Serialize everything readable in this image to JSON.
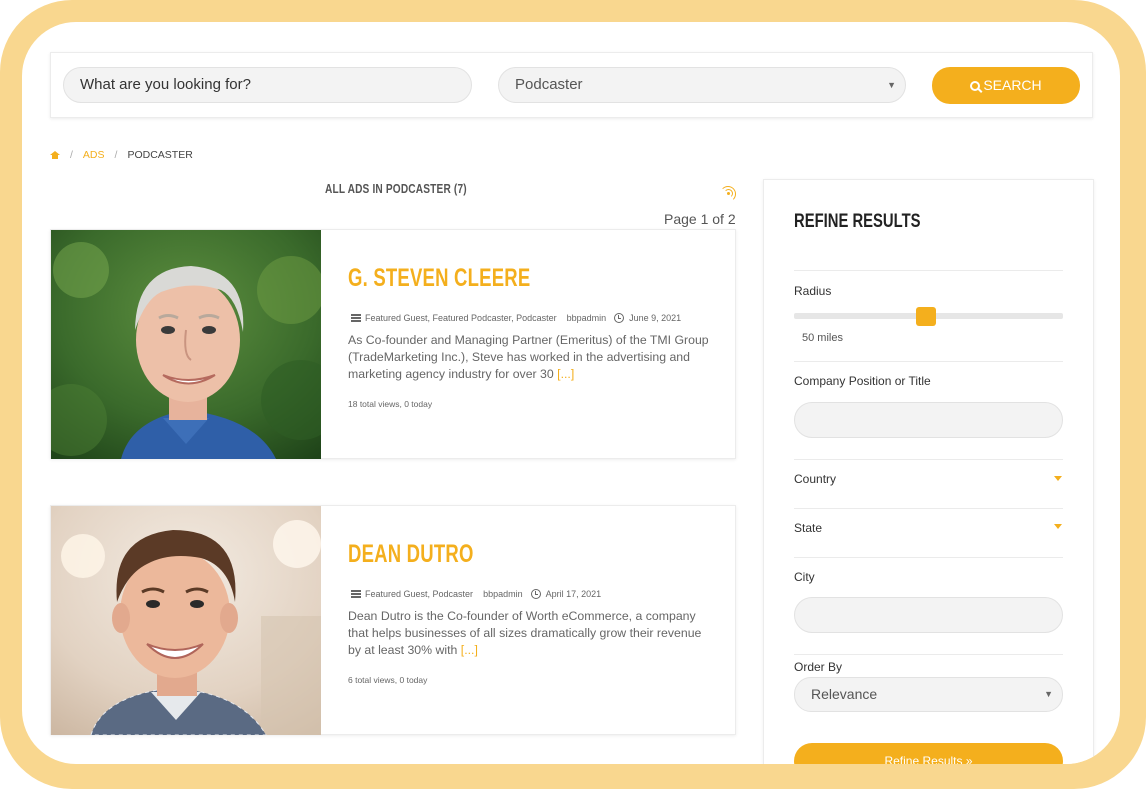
{
  "search": {
    "placeholder": "What are you looking for?",
    "category": "Podcaster",
    "button_label": "SEARCH"
  },
  "breadcrumb": {
    "ads": "ADS",
    "current": "PODCASTER"
  },
  "listing": {
    "title": "ALL ADS IN PODCASTER (7)",
    "page_info": "Page 1 of 2"
  },
  "ads": [
    {
      "name": "G. STEVEN CLEERE",
      "categories": "Featured Guest, Featured Podcaster, Podcaster",
      "author": "bbpadmin",
      "date": "June 9, 2021",
      "description": "As Co-founder and Managing Partner (Emeritus) of the TMI Group (TradeMarketing Inc.), Steve has worked in the advertising and marketing agency industry for over 30",
      "more": "[...]",
      "views": "18 total views, 0 today"
    },
    {
      "name": "DEAN DUTRO",
      "categories": "Featured Guest, Podcaster",
      "author": "bbpadmin",
      "date": "April 17, 2021",
      "description": "Dean Dutro is the Co-founder of Worth eCommerce, a company that helps businesses of all sizes dramatically grow their revenue by at least 30% with",
      "more": "[...]",
      "views": "6 total views, 0 today"
    }
  ],
  "sidebar": {
    "title": "REFINE RESULTS",
    "radius_label": "Radius",
    "radius_value": "50 miles",
    "radius_fraction": 0.49,
    "company_label": "Company Position or Title",
    "country_label": "Country",
    "state_label": "State",
    "city_label": "City",
    "order_label": "Order By",
    "order_value": "Relevance",
    "refine_button": "Refine Results »"
  },
  "colors": {
    "accent": "#f4af1d",
    "frame": "#f9d78f"
  }
}
